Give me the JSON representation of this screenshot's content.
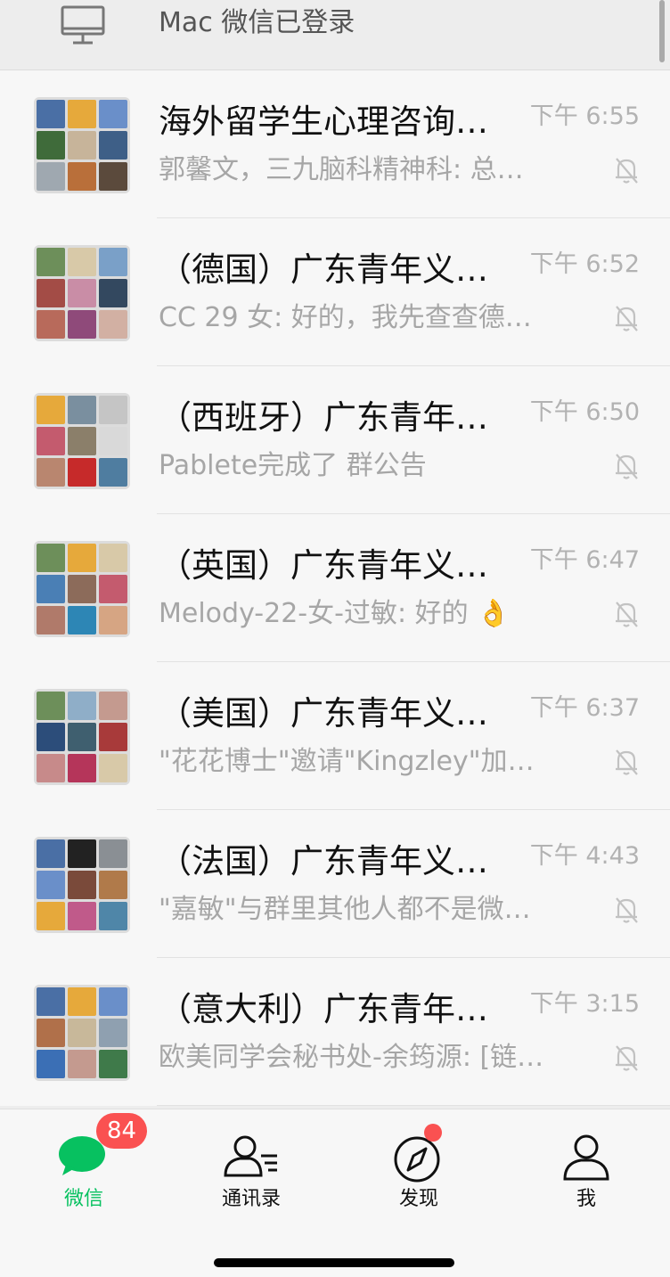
{
  "mac_login": {
    "text": "Mac 微信已登录",
    "icon": "monitor-icon"
  },
  "chats": [
    {
      "title": "海外留学生心理咨询…",
      "time": "下午 6:55",
      "message": "郭馨文，三九脑科精神科: 总…",
      "muted": true,
      "avatar_colors": [
        "#4a6fa5",
        "#e6a93b",
        "#6a8fc9",
        "#3f6b3a",
        "#c7b49a",
        "#3e5f87",
        "#9fa8b0",
        "#b96f3a",
        "#5b4a3c"
      ]
    },
    {
      "title": "（德国）广东青年义…",
      "time": "下午 6:52",
      "message": "CC 29 女: 好的，我先查查德…",
      "muted": true,
      "avatar_colors": [
        "#6d8f5a",
        "#d8c9a8",
        "#7aa0c8",
        "#a34c46",
        "#c98da6",
        "#33485f",
        "#b86a5b",
        "#8f4a7a",
        "#d2b0a3"
      ]
    },
    {
      "title": "（西班牙）广东青年…",
      "time": "下午 6:50",
      "message": "Pablete完成了 群公告",
      "muted": true,
      "avatar_colors": [
        "#e6a93b",
        "#7a8f9f",
        "#c5c5c5",
        "#c45b6e",
        "#8b7f6a",
        "#d9d9d9",
        "#b9866f",
        "#c62a2a",
        "#4f7da0"
      ]
    },
    {
      "title": "（英国）广东青年义…",
      "time": "下午 6:47",
      "message": "Melody-22-女-过敏: 好的 👌",
      "muted": true,
      "avatar_colors": [
        "#6d8f5a",
        "#e6a93b",
        "#d8c9a8",
        "#4a7fb5",
        "#8c6b5a",
        "#c45b6e",
        "#b07a6a",
        "#2d86b5",
        "#d6a583"
      ]
    },
    {
      "title": "（美国）广东青年义…",
      "time": "下午 6:37",
      "message": "\"花花博士\"邀请\"Kingzley\"加入…",
      "muted": true,
      "avatar_colors": [
        "#6d8f5a",
        "#8faec8",
        "#c49a8f",
        "#2c4d7a",
        "#3f5f6f",
        "#a83a3a",
        "#c78a8a",
        "#b5355a",
        "#d8c9a8"
      ]
    },
    {
      "title": "（法国）广东青年义…",
      "time": "下午 4:43",
      "message": "\"嘉敏\"与群里其他人都不是微…",
      "muted": true,
      "avatar_colors": [
        "#4a6fa5",
        "#222222",
        "#8a8f94",
        "#6a8fc9",
        "#7a4a3a",
        "#b07a4a",
        "#e6a93b",
        "#c05a8a",
        "#4f86a8"
      ]
    },
    {
      "title": "（意大利）广东青年…",
      "time": "下午 3:15",
      "message": "欧美同学会秘书处-余筠源: [链…",
      "muted": true,
      "avatar_colors": [
        "#4a6fa5",
        "#e6a93b",
        "#6a8fc9",
        "#b0704a",
        "#c8b89a",
        "#8fa0b0",
        "#3b6fb5",
        "#c49a8f",
        "#3f7a4a"
      ]
    }
  ],
  "tabbar": {
    "tabs": [
      {
        "label": "微信",
        "icon": "chat-bubble-icon",
        "badge": "84",
        "active": true
      },
      {
        "label": "通讯录",
        "icon": "contacts-icon"
      },
      {
        "label": "发现",
        "icon": "compass-icon",
        "dot": true
      },
      {
        "label": "我",
        "icon": "person-icon"
      }
    ]
  },
  "colors": {
    "accent": "#07c160",
    "badge": "#fa5151",
    "background": "#ededed"
  }
}
